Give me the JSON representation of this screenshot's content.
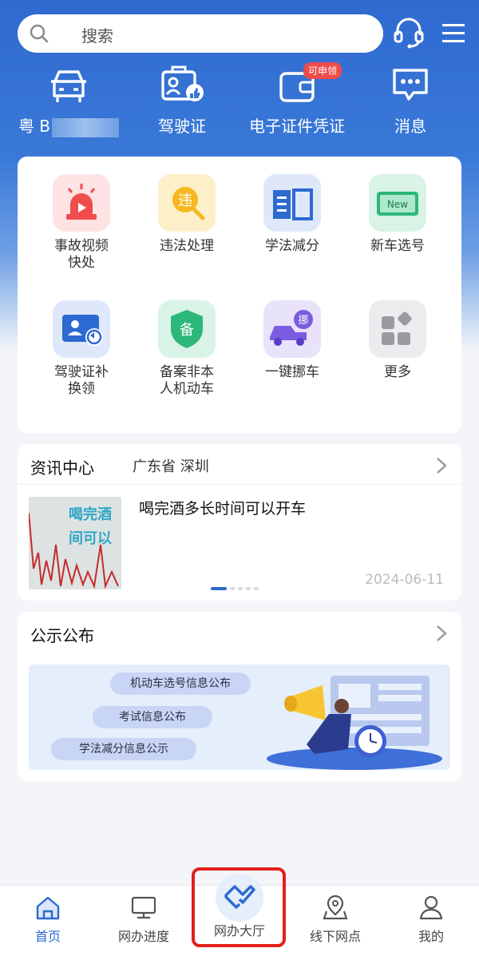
{
  "colors": {
    "brand": "#2f6ad0",
    "accent_red": "#e1201c",
    "badge_red": "#ee4b4b"
  },
  "search": {
    "placeholder": "搜索"
  },
  "header_icons": [
    "headset-icon",
    "menu-icon"
  ],
  "shortcuts": [
    {
      "icon": "car-icon",
      "label": "粤 B"
    },
    {
      "icon": "license-icon",
      "label": "驾驶证"
    },
    {
      "icon": "wallet-icon",
      "label": "电子证件凭证",
      "badge": "可申领"
    },
    {
      "icon": "message-icon",
      "label": "消息"
    }
  ],
  "services": [
    {
      "icon": "siren-icon",
      "label": [
        "事故视频",
        "快处"
      ]
    },
    {
      "icon": "violation-icon",
      "label": [
        "违法处理"
      ]
    },
    {
      "icon": "book-icon",
      "label": [
        "学法减分"
      ]
    },
    {
      "icon": "new-plate-icon",
      "label": [
        "新车选号"
      ]
    },
    {
      "icon": "id-card-replace-icon",
      "label": [
        "驾驶证补",
        "换领"
      ]
    },
    {
      "icon": "shield-register-icon",
      "label": [
        "备案非本",
        "人机动车"
      ]
    },
    {
      "icon": "tow-truck-icon",
      "label": [
        "一键挪车"
      ]
    },
    {
      "icon": "more-grid-icon",
      "label": [
        "更多"
      ]
    }
  ],
  "news": {
    "title": "资讯中心",
    "region": "广东省 深圳",
    "item": {
      "headline": "喝完酒多长时间可以开车",
      "thumb_text": [
        "喝完酒",
        "间可以"
      ],
      "date": "2024-06-11"
    },
    "pager": {
      "total": 5,
      "current": 1
    }
  },
  "notice": {
    "title": "公示公布",
    "pills": [
      "机动车选号信息公布",
      "考试信息公布",
      "学法减分信息公示"
    ]
  },
  "nav": [
    {
      "icon": "home-icon",
      "label": "首页",
      "active": true
    },
    {
      "icon": "monitor-icon",
      "label": "网办进度"
    },
    {
      "icon": "handshake-icon",
      "label": "网办大厅",
      "highlighted": true
    },
    {
      "icon": "location-pin-icon",
      "label": "线下网点"
    },
    {
      "icon": "user-icon",
      "label": "我的"
    }
  ]
}
